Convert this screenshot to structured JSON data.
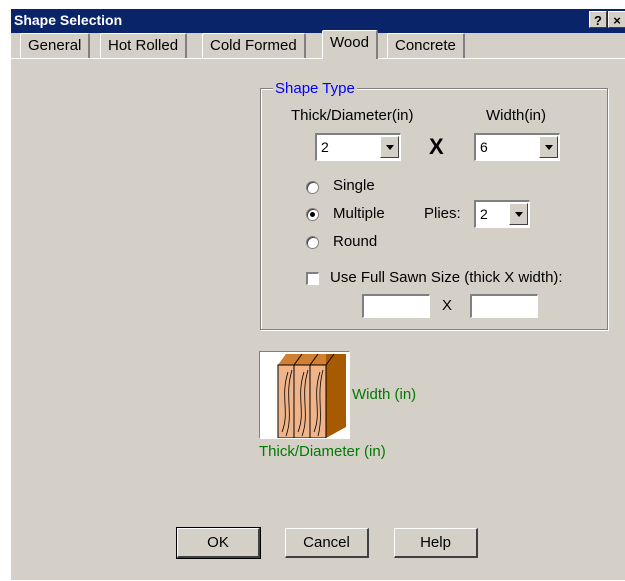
{
  "window": {
    "title": "Shape Selection",
    "help_button": "?",
    "close_button": "×"
  },
  "tabs": [
    {
      "label": "General"
    },
    {
      "label": "Hot Rolled"
    },
    {
      "label": "Cold Formed"
    },
    {
      "label": "Wood",
      "active": true
    },
    {
      "label": "Concrete"
    }
  ],
  "shape_type": {
    "legend": "Shape Type",
    "thick_label": "Thick/Diameter(in)",
    "width_label": "Width(in)",
    "thick_value": "2",
    "times_symbol": "X",
    "width_value": "6",
    "options": [
      {
        "label": "Single",
        "selected": false
      },
      {
        "label": "Multiple",
        "selected": true
      },
      {
        "label": "Round",
        "selected": false
      }
    ],
    "plies_label": "Plies:",
    "plies_value": "2",
    "full_sawn_label": "Use Full Sawn Size (thick X width):",
    "full_sawn_checked": false,
    "full_sawn_thick": "",
    "full_sawn_x": "X",
    "full_sawn_width": ""
  },
  "diagram": {
    "width_label": "Width (in)",
    "thick_label": "Thick/Diameter (in)"
  },
  "buttons": {
    "ok": "OK",
    "cancel": "Cancel",
    "help": "Help"
  },
  "colors": {
    "titlebar": "#0a246a",
    "legend": "#0000ff",
    "diagram_text": "#007a00",
    "wood_light": "#f0b48a",
    "wood_dark": "#a85a00"
  }
}
